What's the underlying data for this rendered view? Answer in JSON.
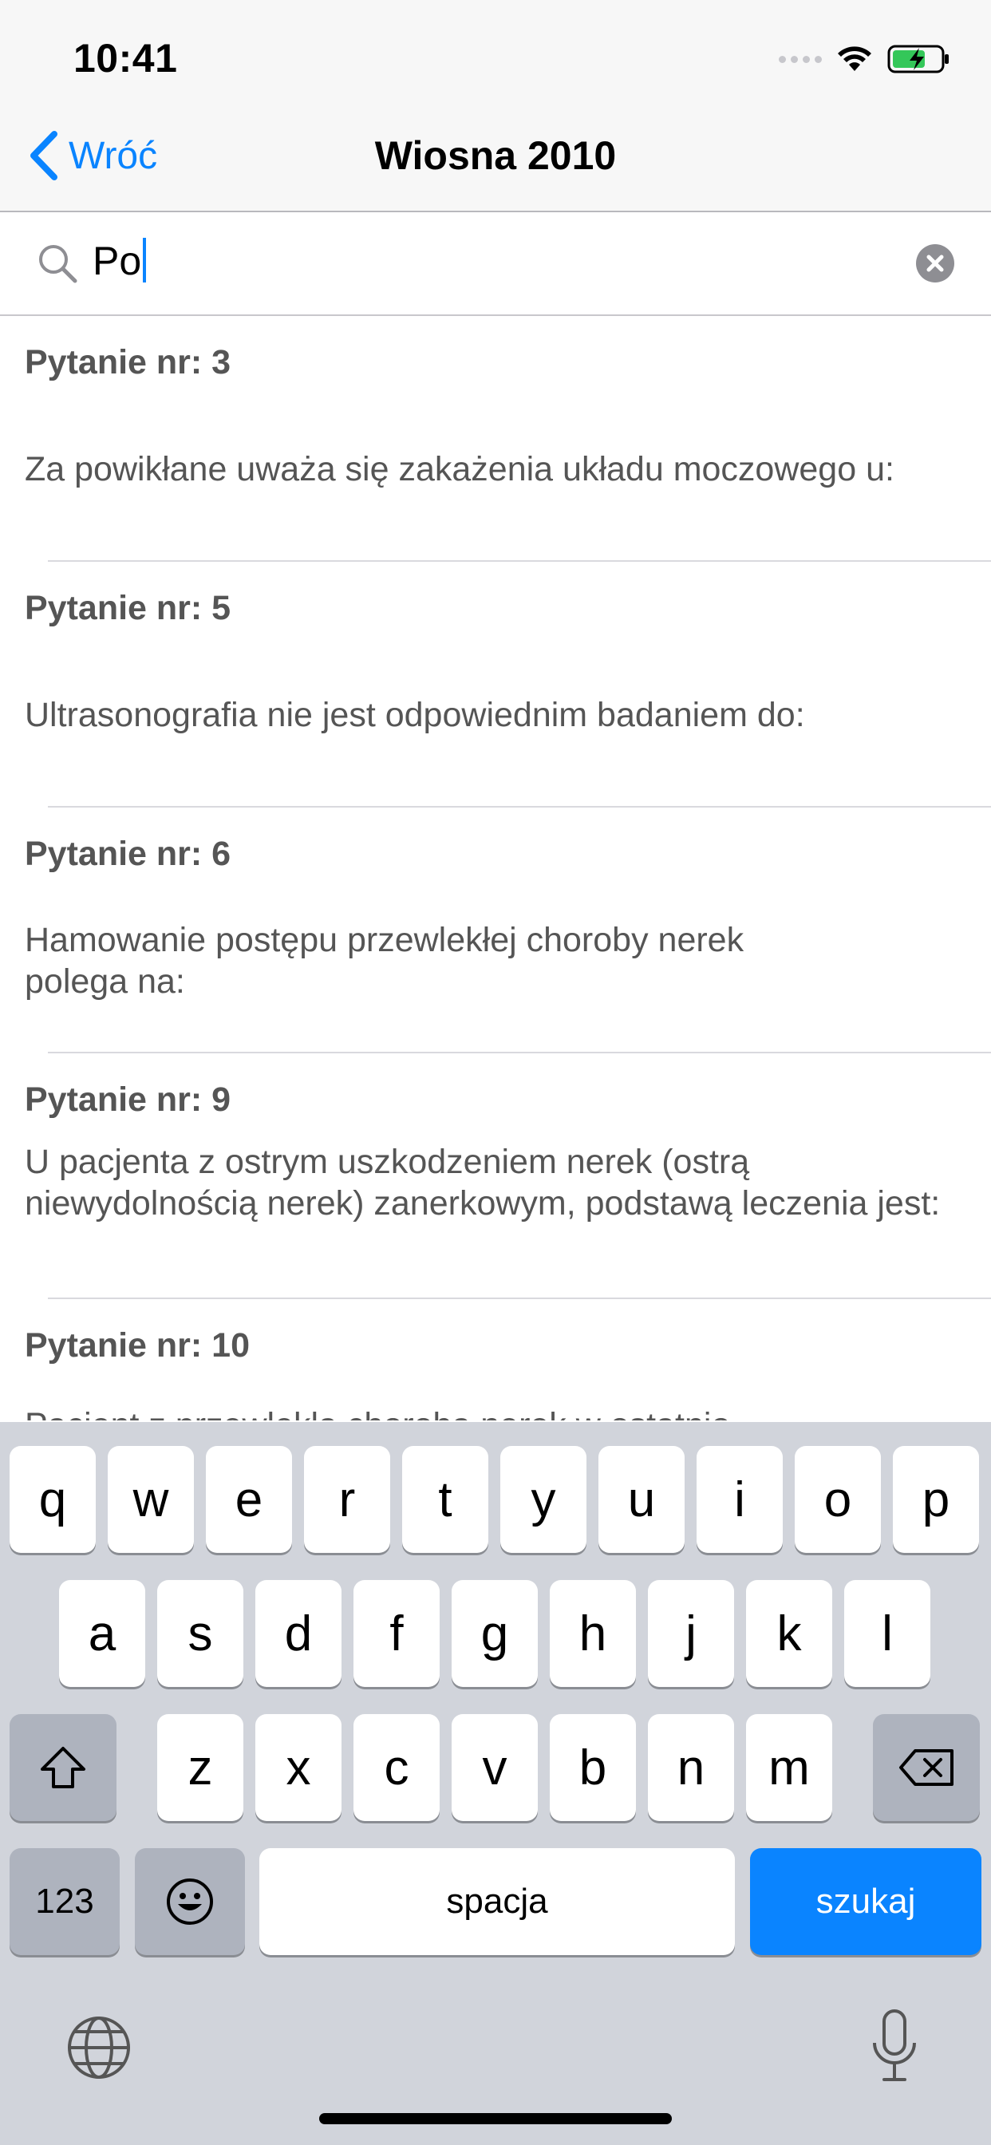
{
  "status": {
    "time": "10:41"
  },
  "nav": {
    "back_label": "Wróć",
    "title": "Wiosna 2010"
  },
  "search": {
    "value": "Po"
  },
  "items": [
    {
      "qnum": "Pytanie nr: 3",
      "text": "Za powikłane uważa się zakażenia układu moczowego u:"
    },
    {
      "qnum": "Pytanie nr: 5",
      "text": "Ultrasonografia nie jest odpowiednim badaniem do:"
    },
    {
      "qnum": "Pytanie nr: 6",
      "text": "Hamowanie postępu przewlekłej choroby nerek\npolega na:"
    },
    {
      "qnum": "Pytanie nr: 9",
      "text": "U pacjenta z ostrym uszkodzeniem nerek (ostrą niewydolnością nerek) zanerkowym, podstawą leczenia jest:"
    },
    {
      "qnum": "Pytanie nr: 10",
      "text": "Pacjent z przewlekłą chorobą nerek w ostatnio"
    }
  ],
  "keyboard": {
    "row1": [
      "q",
      "w",
      "e",
      "r",
      "t",
      "y",
      "u",
      "i",
      "o",
      "p"
    ],
    "row2": [
      "a",
      "s",
      "d",
      "f",
      "g",
      "h",
      "j",
      "k",
      "l"
    ],
    "row3": [
      "z",
      "x",
      "c",
      "v",
      "b",
      "n",
      "m"
    ],
    "numbers_label": "123",
    "space_label": "spacja",
    "search_label": "szukaj"
  },
  "icons": [
    "wifi-icon",
    "battery-charging-icon",
    "chevron-left-icon",
    "search-icon",
    "clear-icon",
    "shift-icon",
    "backspace-icon",
    "emoji-icon",
    "globe-icon",
    "microphone-icon"
  ],
  "colors": {
    "accent": "#0a84ff",
    "keyboard_bg": "#d1d4db",
    "key_bg": "#ffffff",
    "key_dark": "#aeb3be"
  }
}
